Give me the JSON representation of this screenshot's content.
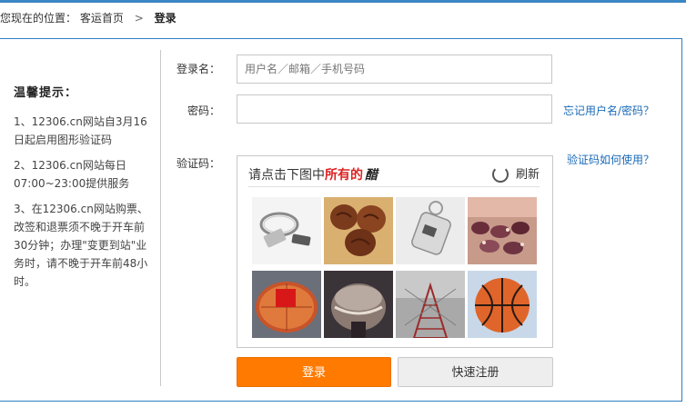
{
  "header": {
    "location_prefix": "您现在的位置：",
    "home_link": "客运首页",
    "separator": ">",
    "current": "登录"
  },
  "tips": {
    "title": "温馨提示：",
    "items": [
      "1、12306.cn网站自3月16日起启用图形验证码",
      "2、12306.cn网站每日07:00~23:00提供服务",
      "3、在12306.cn网站购票、改签和退票须不晚于开车前30分钟；办理\"变更到站\"业务时，请不晚于开车前48小时。"
    ]
  },
  "form": {
    "username_label": "登录名：",
    "username_placeholder": "用户名／邮箱／手机号码",
    "password_label": "密码：",
    "password_value": "",
    "forgot_link": "忘记用户名/密码？",
    "captcha_label": "验证码：",
    "captcha_help_link": "验证码如何使用？"
  },
  "captcha": {
    "prompt_prefix": "请点击下图中",
    "prompt_highlight": "所有的",
    "prompt_word": "醋",
    "refresh_label": "刷新",
    "tiles": [
      {
        "name": "key-ring-icon"
      },
      {
        "name": "walnut-icon"
      },
      {
        "name": "usb-key-icon"
      },
      {
        "name": "candy-icon"
      },
      {
        "name": "vinegar-lantern-icon"
      },
      {
        "name": "dome-building-icon"
      },
      {
        "name": "tower-structure-icon"
      },
      {
        "name": "basketball-icon"
      }
    ]
  },
  "buttons": {
    "login": "登录",
    "register": "快速注册"
  },
  "colors": {
    "accent_blue": "#2f7ec0",
    "link_blue": "#1a6ab7",
    "login_orange": "#ff7a00"
  }
}
